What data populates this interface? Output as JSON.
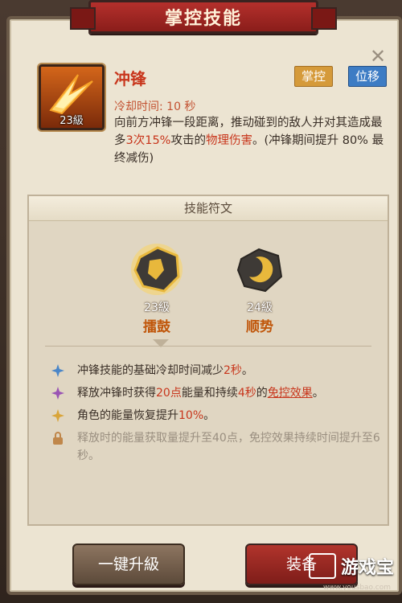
{
  "title": "掌控技能",
  "close_glyph": "✕",
  "skill": {
    "level": "23級",
    "name": "冲锋",
    "tags": [
      "掌控",
      "位移"
    ],
    "cooldown": "冷却时间: 10 秒",
    "desc_parts": [
      "向前方冲锋一段距离，推动碰到的敌人并对其造成最多",
      "3次15%",
      "攻击的",
      "物理伤害",
      "。(冲锋期间提升 80% 最终减伤)"
    ]
  },
  "runes": {
    "header": "技能符文",
    "items": [
      {
        "level": "23級",
        "name": "擂鼓",
        "icon": "drum-rune-icon"
      },
      {
        "level": "24級",
        "name": "顺势",
        "icon": "crescent-rune-icon"
      }
    ]
  },
  "effects": [
    {
      "parts": [
        "冲锋技能的基础冷却时间减少",
        "2秒",
        "。"
      ],
      "icon": "blue-diamond-icon",
      "color": "#4a86c8"
    },
    {
      "parts": [
        "释放冲锋时获得",
        "20点",
        "能量和持续",
        "4秒",
        "的",
        "免控效果",
        "。"
      ],
      "icon": "purple-diamond-icon",
      "color": "#9a54b4"
    },
    {
      "parts": [
        "角色的能量恢复提升",
        "10%",
        "。"
      ],
      "icon": "gold-diamond-icon",
      "color": "#d9a53a"
    },
    {
      "parts": [
        "释放时的能量获取量提升至40点，免控效果持续时间提升至6秒。"
      ],
      "icon": "lock-icon",
      "color": "#c0874a"
    }
  ],
  "buttons": {
    "upgrade": "一键升級",
    "equip": "装备"
  },
  "watermark": {
    "text": "游戏宝",
    "url": "www.yousbao.com"
  }
}
